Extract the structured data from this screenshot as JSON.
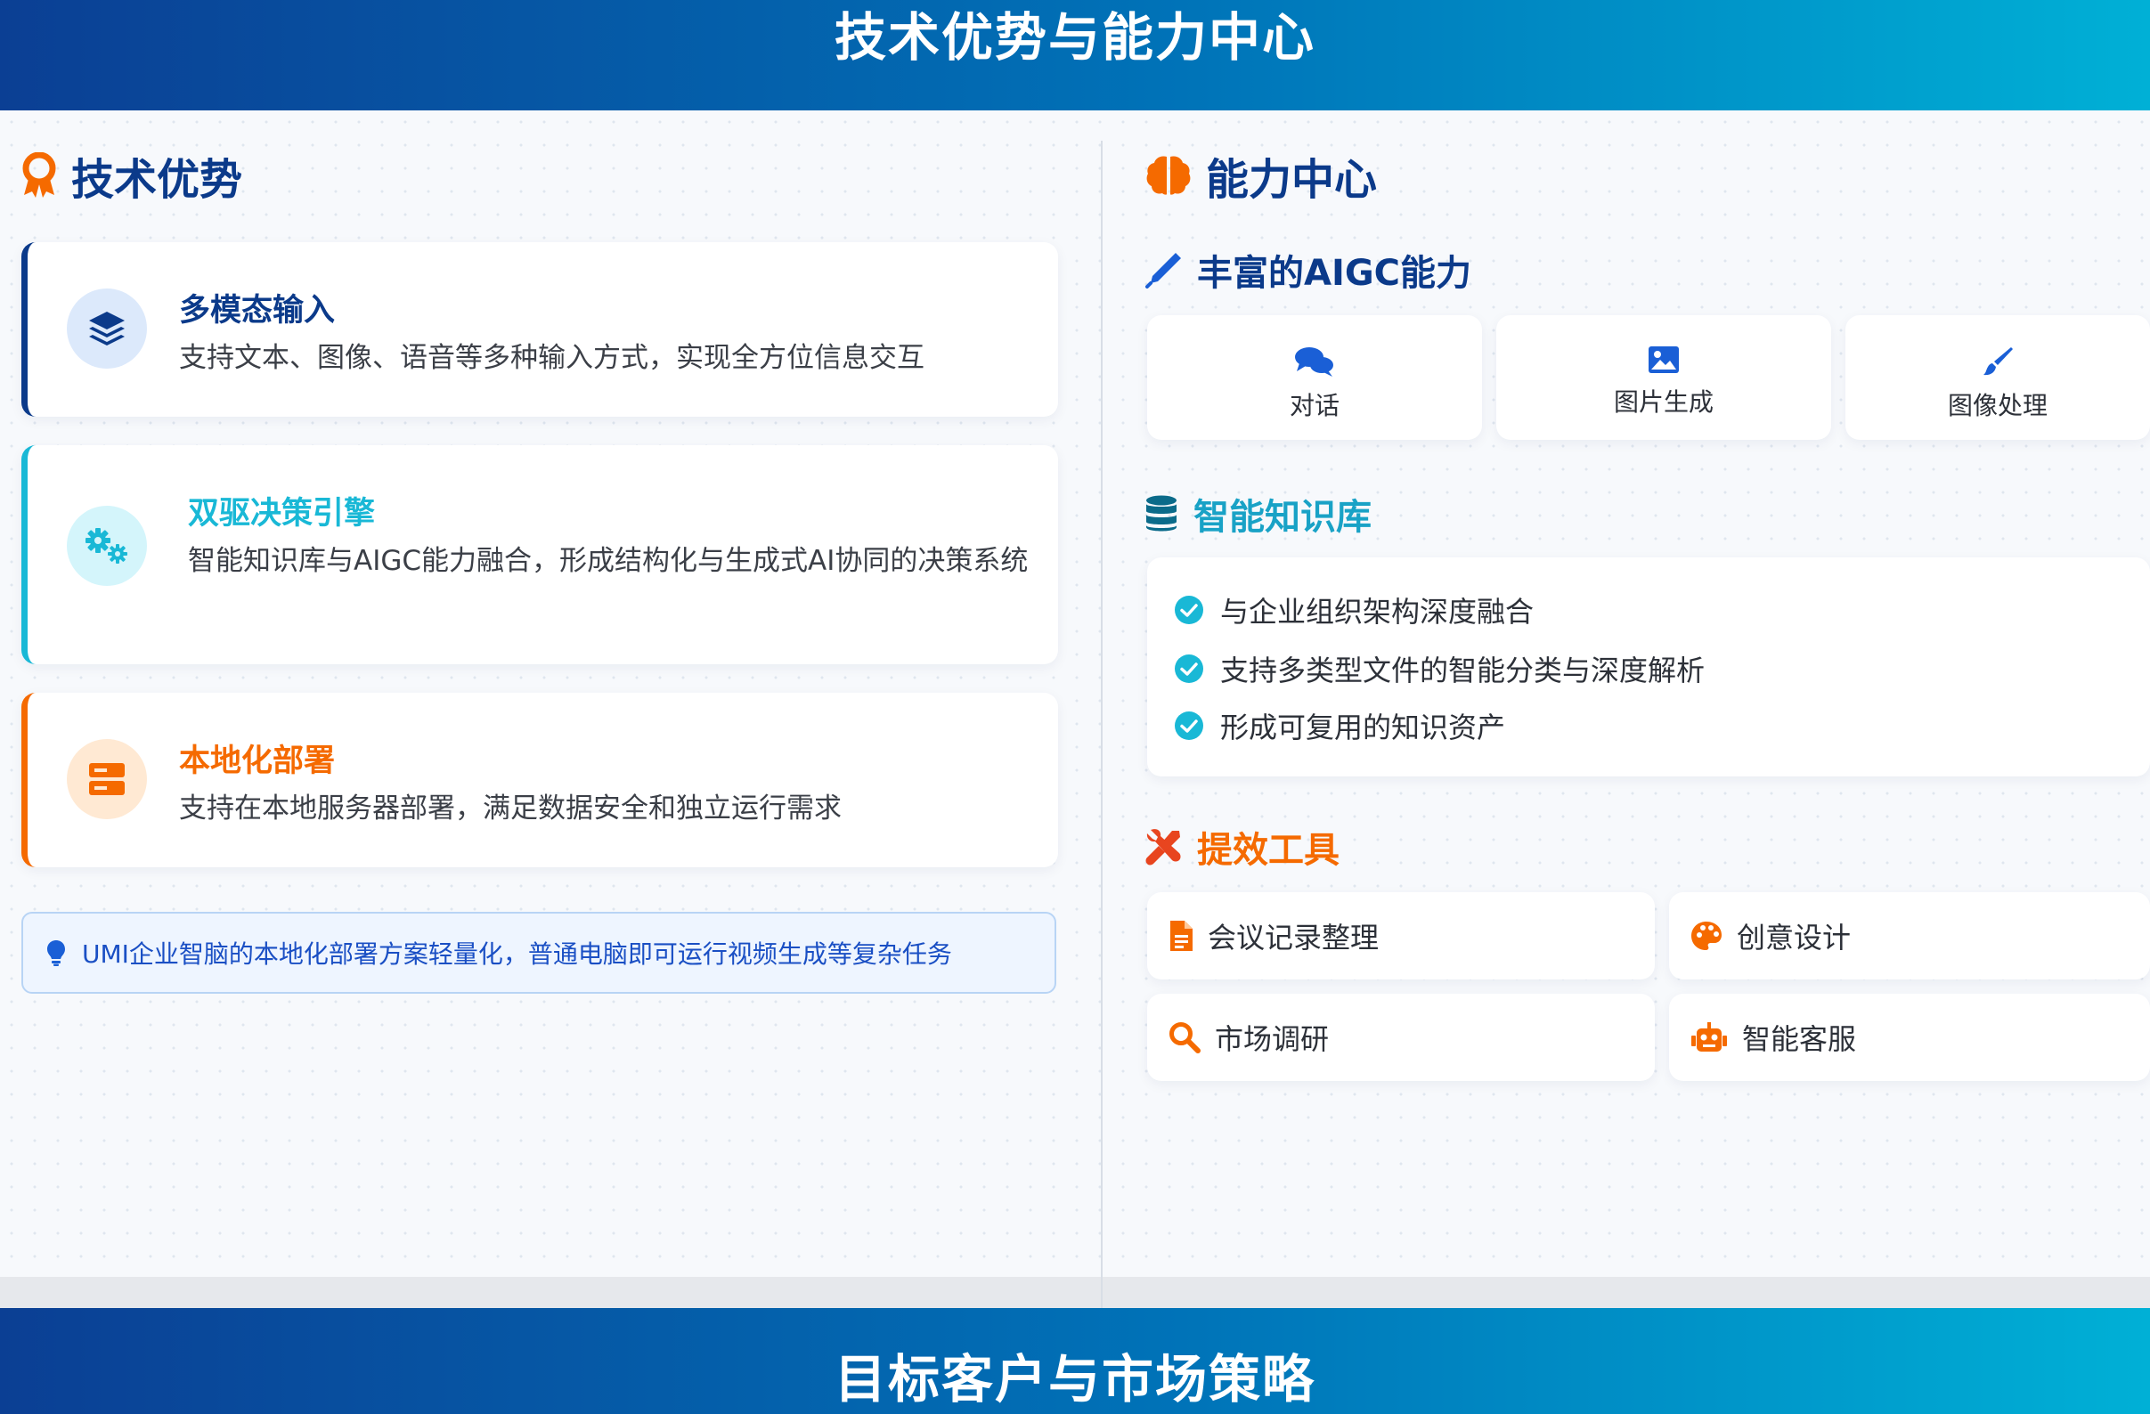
{
  "header": {
    "title": "技术优势与能力中心"
  },
  "footer": {
    "title": "目标客户与市场策略"
  },
  "left": {
    "title": "技术优势",
    "features": [
      {
        "title": "多模态输入",
        "desc": "支持文本、图像、语音等多种输入方式，实现全方位信息交互",
        "color": "#0b3a8a"
      },
      {
        "title": "双驱决策引擎",
        "desc": "智能知识库与AIGC能力融合，形成结构化与生成式AI协同的决策系统",
        "color": "#19b8d6"
      },
      {
        "title": "本地化部署",
        "desc": "支持在本地服务器部署，满足数据安全和独立运行需求",
        "color": "#f56a00"
      }
    ],
    "tip": "UMI企业智脑的本地化部署方案轻量化，普通电脑即可运行视频生成等复杂任务"
  },
  "right": {
    "title": "能力中心",
    "aigc": {
      "title": "丰富的AIGC能力",
      "items": [
        {
          "label": "对话",
          "icon": "comments-icon"
        },
        {
          "label": "图片生成",
          "icon": "image-icon"
        },
        {
          "label": "图像处理",
          "icon": "paintbrush-icon"
        }
      ]
    },
    "kb": {
      "title": "智能知识库",
      "items": [
        "与企业组织架构深度融合",
        "支持多类型文件的智能分类与深度解析",
        "形成可复用的知识资产"
      ]
    },
    "tools": {
      "title": "提效工具",
      "items": [
        {
          "label": "会议记录整理",
          "icon": "file-icon"
        },
        {
          "label": "创意设计",
          "icon": "palette-icon"
        },
        {
          "label": "市场调研",
          "icon": "search-icon"
        },
        {
          "label": "智能客服",
          "icon": "robot-icon"
        }
      ]
    }
  },
  "colors": {
    "navy": "#0b3a8a",
    "cyan": "#19b8d6",
    "orange": "#f56a00",
    "blue": "#1a5fd6"
  }
}
